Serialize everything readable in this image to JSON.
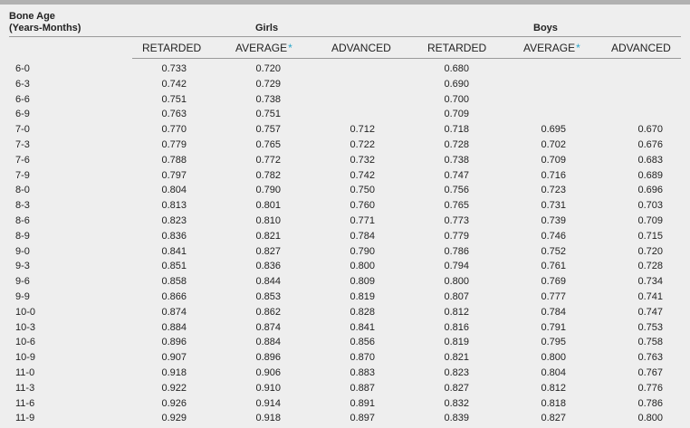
{
  "header": {
    "stub_line1": "Bone Age",
    "stub_line2": "(Years-Months)",
    "girls": "Girls",
    "boys": "Boys"
  },
  "columns": {
    "girls_retarded": "RETARDED",
    "girls_average": "AVERAGE",
    "girls_advanced": "ADVANCED",
    "boys_retarded": "RETARDED",
    "boys_average": "AVERAGE",
    "boys_advanced": "ADVANCED",
    "asterisk": "*"
  },
  "colors": {
    "asterisk": "#2aa6c9",
    "background": "#eeeeee",
    "top_bar": "#b1b1b1"
  },
  "rows": [
    [
      "6-0",
      "0.733",
      "0.720",
      "",
      "0.680",
      "",
      ""
    ],
    [
      "6-3",
      "0.742",
      "0.729",
      "",
      "0.690",
      "",
      ""
    ],
    [
      "6-6",
      "0.751",
      "0.738",
      "",
      "0.700",
      "",
      ""
    ],
    [
      "6-9",
      "0.763",
      "0.751",
      "",
      "0.709",
      "",
      ""
    ],
    [
      "7-0",
      "0.770",
      "0.757",
      "0.712",
      "0.718",
      "0.695",
      "0.670"
    ],
    [
      "7-3",
      "0.779",
      "0.765",
      "0.722",
      "0.728",
      "0.702",
      "0.676"
    ],
    [
      "7-6",
      "0.788",
      "0.772",
      "0.732",
      "0.738",
      "0.709",
      "0.683"
    ],
    [
      "7-9",
      "0.797",
      "0.782",
      "0.742",
      "0.747",
      "0.716",
      "0.689"
    ],
    [
      "8-0",
      "0.804",
      "0.790",
      "0.750",
      "0.756",
      "0.723",
      "0.696"
    ],
    [
      "8-3",
      "0.813",
      "0.801",
      "0.760",
      "0.765",
      "0.731",
      "0.703"
    ],
    [
      "8-6",
      "0.823",
      "0.810",
      "0.771",
      "0.773",
      "0.739",
      "0.709"
    ],
    [
      "8-9",
      "0.836",
      "0.821",
      "0.784",
      "0.779",
      "0.746",
      "0.715"
    ],
    [
      "9-0",
      "0.841",
      "0.827",
      "0.790",
      "0.786",
      "0.752",
      "0.720"
    ],
    [
      "9-3",
      "0.851",
      "0.836",
      "0.800",
      "0.794",
      "0.761",
      "0.728"
    ],
    [
      "9-6",
      "0.858",
      "0.844",
      "0.809",
      "0.800",
      "0.769",
      "0.734"
    ],
    [
      "9-9",
      "0.866",
      "0.853",
      "0.819",
      "0.807",
      "0.777",
      "0.741"
    ],
    [
      "10-0",
      "0.874",
      "0.862",
      "0.828",
      "0.812",
      "0.784",
      "0.747"
    ],
    [
      "10-3",
      "0.884",
      "0.874",
      "0.841",
      "0.816",
      "0.791",
      "0.753"
    ],
    [
      "10-6",
      "0.896",
      "0.884",
      "0.856",
      "0.819",
      "0.795",
      "0.758"
    ],
    [
      "10-9",
      "0.907",
      "0.896",
      "0.870",
      "0.821",
      "0.800",
      "0.763"
    ],
    [
      "11-0",
      "0.918",
      "0.906",
      "0.883",
      "0.823",
      "0.804",
      "0.767"
    ],
    [
      "11-3",
      "0.922",
      "0.910",
      "0.887",
      "0.827",
      "0.812",
      "0.776"
    ],
    [
      "11-6",
      "0.926",
      "0.914",
      "0.891",
      "0.832",
      "0.818",
      "0.786"
    ],
    [
      "11-9",
      "0.929",
      "0.918",
      "0.897",
      "0.839",
      "0.827",
      "0.800"
    ]
  ]
}
